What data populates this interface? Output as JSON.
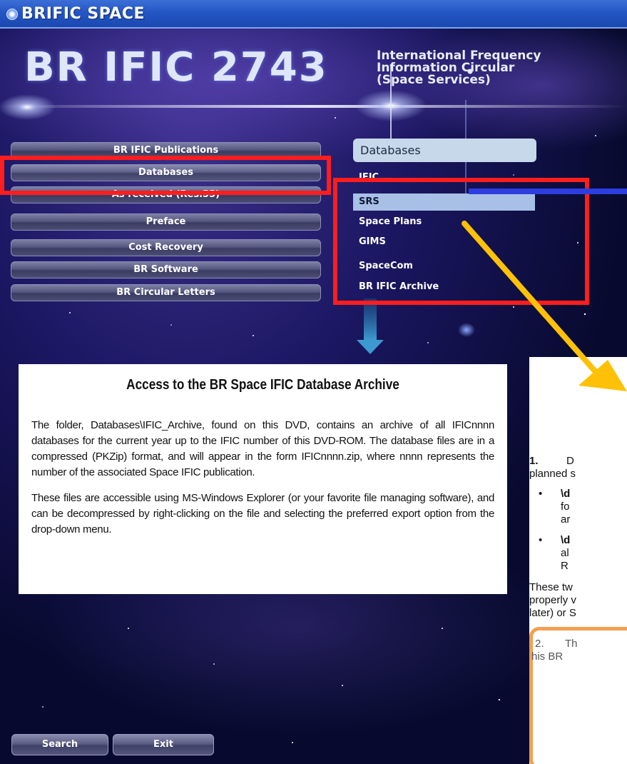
{
  "window": {
    "title": "BRIFIC SPACE"
  },
  "header": {
    "title": "BR IFIC 2743",
    "subtitle_lines": [
      "International Frequency",
      "Information Circular",
      "(Space Services)"
    ]
  },
  "nav": {
    "items": [
      {
        "label": "BR IFIC Publications"
      },
      {
        "label": "Databases"
      },
      {
        "label": "As received (Res.55)"
      },
      {
        "label": "Preface"
      },
      {
        "label": "Cost Recovery"
      },
      {
        "label": "BR Software"
      },
      {
        "label": "BR Circular Letters"
      }
    ],
    "active": "Databases"
  },
  "databases": {
    "header": "Databases",
    "items": [
      {
        "label": "IFIC"
      },
      {
        "label": "SRS"
      },
      {
        "label": "Space Plans"
      },
      {
        "label": "GIMS"
      },
      {
        "label": "SpaceCom"
      },
      {
        "label": "BR IFIC Archive"
      }
    ],
    "selected": "SRS"
  },
  "doc": {
    "title": "Access to the BR Space IFIC Database Archive",
    "p1": "The folder, Databases\\IFIC_Archive, found on this DVD, contains an archive of all IFICnnnn databases for the current year up to the IFIC number of this DVD-ROM. The database files are in a compressed (PKZip) format, and will appear in the form IFICnnnn.zip, where nnnn represents the number of the associated Space IFIC publication.",
    "p2": "These files are accessible using MS-Windows Explorer (or your favorite file managing software), and can be decompressed by right-clicking on the file and selecting the preferred export option from the drop-down menu."
  },
  "side_doc": {
    "item1_num": "1.",
    "item1_text": "D",
    "item1_line2": "planned s",
    "bullet1_a": "\\d",
    "bullet1_b": "fo",
    "bullet1_c": "ar",
    "bullet2_a": "\\d",
    "bullet2_b": "al",
    "bullet2_c": "R",
    "p_line1": "These tw",
    "p_line2": "properly v",
    "p_line3": "later) or S",
    "item2_num": "2.",
    "item2_text": "Th",
    "item2_line2": "his BR"
  },
  "buttons": {
    "search": "Search",
    "exit": "Exit"
  },
  "colors": {
    "highlight": "#ff1d1d",
    "arrow": "#ffc107",
    "blue_line": "#2d3de0",
    "orange_box": "#f0a050"
  }
}
